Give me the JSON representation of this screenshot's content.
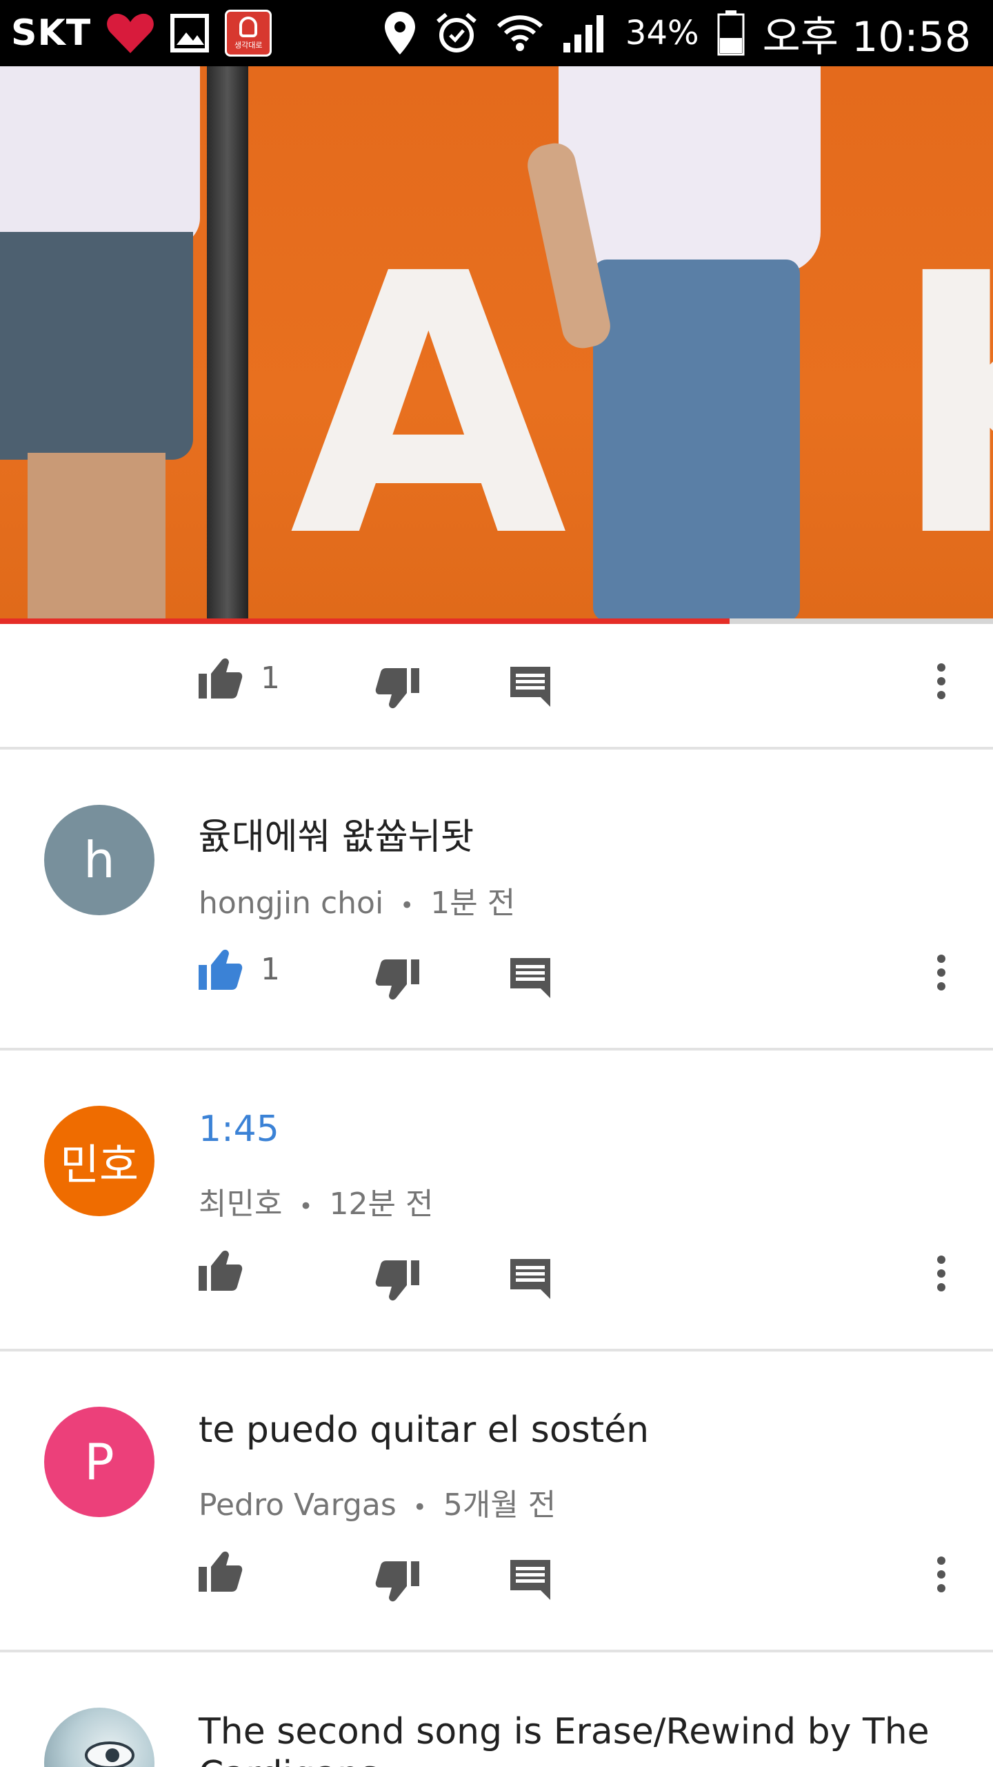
{
  "status_bar": {
    "carrier": "SKT",
    "app_badge_label": "생각대로",
    "battery": "34%",
    "time": "오후 10:58"
  },
  "video": {
    "progress_fraction": 0.735
  },
  "top_actions": {
    "like_count": "1"
  },
  "colors": {
    "accent_blue": "#3b82d6",
    "progress_red": "#e52d27",
    "icon_gray": "#555555"
  },
  "comments": [
    {
      "avatar_letter": "h",
      "avatar_color": "#78909c",
      "text": "윬대에쒀 왒쓥뉘돳",
      "author": "hongjin choi",
      "time": "1분 전",
      "like_count": "1",
      "liked": true
    },
    {
      "avatar_letter": "민호",
      "avatar_color": "#ef6c00",
      "text": "1:45",
      "author": "최민호",
      "time": "12분 전",
      "like_count": "",
      "liked": false
    },
    {
      "avatar_letter": "P",
      "avatar_color": "#ec407a",
      "text": "te puedo quitar el sostén",
      "author": "Pedro Vargas",
      "time": "5개월 전",
      "like_count": "",
      "liked": false
    },
    {
      "text": "The second song is Erase/Rewind by The Cardigans"
    }
  ],
  "separator": "•"
}
